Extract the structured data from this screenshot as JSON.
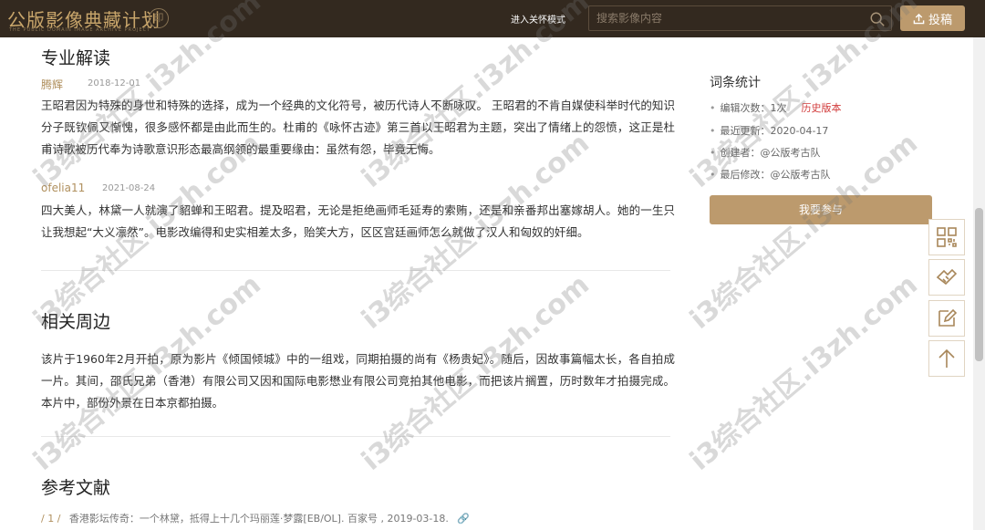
{
  "header": {
    "logo_text": "公版影像典藏计划",
    "care_mode_label": "进入关怀模式",
    "search_placeholder": "搜索影像内容",
    "upload_label": "投稿"
  },
  "professional": {
    "title": "专业解读",
    "entries": [
      {
        "author": "腾辉",
        "date": "2018-12-01",
        "text": "王昭君因为特殊的身世和特殊的选择，成为一个经典的文化符号，被历代诗人不断咏叹。 王昭君的不肯自媒使科举时代的知识分子既钦佩又惭愧，很多感怀都是由此而生的。杜甫的《咏怀古迹》第三首以王昭君为主题，突出了情绪上的怨愤，这正是杜甫诗歌被历代奉为诗歌意识形态最高纲领的最重要缘由：虽然有怨，毕竟无悔。"
      },
      {
        "author": "ofelia11",
        "date": "2021-08-24",
        "text": "四大美人，林黛一人就演了貂蝉和王昭君。提及昭君，无论是拒绝画师毛延寿的索贿，还是和亲番邦出塞嫁胡人。她的一生只让我想起“大义凛然”。电影改编得和史实相差太多，贻笑大方，区区宫廷画师怎么就做了汉人和匈奴的奸细。"
      }
    ]
  },
  "related": {
    "title": "相关周边",
    "text": "该片于1960年2月开拍，原为影片《倾国倾城》中的一组戏，同期拍摄的尚有《杨贵妃》。随后，因故事篇幅太长，各自拍成一片。其间，邵氏兄弟（香港）有限公司又因和国际电影懋业有限公司竞拍其他电影，而把该片搁置，历时数年才拍摄完成。本片中，部份外景在日本京都拍摄。"
  },
  "references": {
    "title": "参考文献",
    "items": [
      {
        "num": "/ 1 /",
        "text": "香港影坛传奇：一个林黛，抵得上十几个玛丽莲·梦露[EB/OL]. 百家号 , 2019-03-18."
      }
    ]
  },
  "stats": {
    "title": "词条统计",
    "rows": [
      {
        "label": "编辑次数：",
        "value": "1次",
        "link": "历史版本"
      },
      {
        "label": "最近更新：",
        "value": "2020-04-17"
      },
      {
        "label": "创建者：",
        "value": "@公版考古队"
      },
      {
        "label": "最后修改：",
        "value": "@公版考古队"
      }
    ],
    "join_label": "我要参与"
  },
  "float_tools": [
    "qrcode-icon",
    "handshake-icon",
    "edit-icon",
    "arrow-up-icon"
  ],
  "watermark": "i3综合社区.i3zh.com",
  "colors": {
    "header_bg": "#33291f",
    "accent": "#bc9a6d",
    "author": "#b0905e",
    "link_red": "#d23c3c"
  }
}
